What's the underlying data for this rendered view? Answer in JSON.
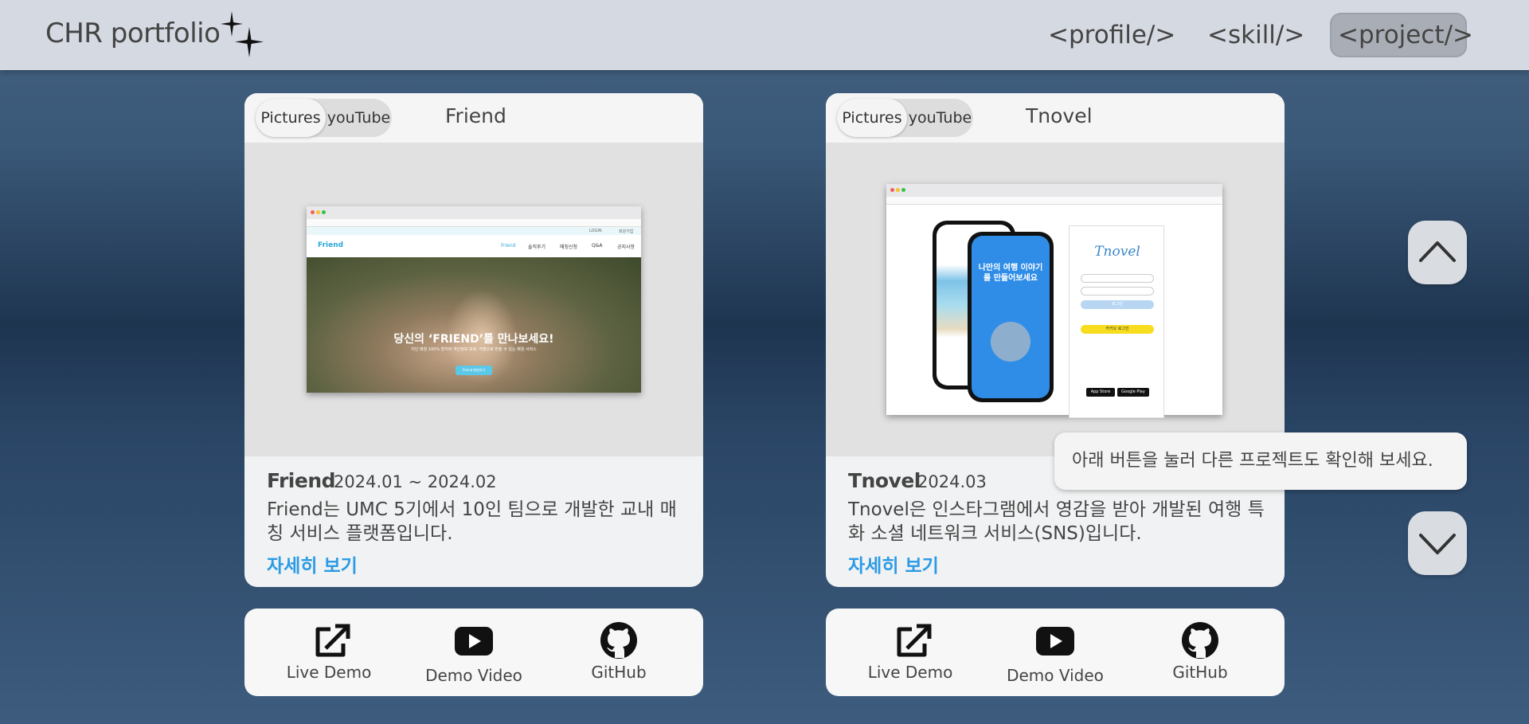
{
  "header": {
    "brand": "CHR portfolio",
    "nav": [
      {
        "label": "<profile/>",
        "active": false
      },
      {
        "label": "<skill/>",
        "active": false
      },
      {
        "label": "<project/>",
        "active": true
      }
    ]
  },
  "toggle": {
    "pictures": "Pictures",
    "youtube": "youTube"
  },
  "projects": [
    {
      "name": "Friend",
      "date": "2024.01 ~ 2024.02",
      "description": "Friend는 UMC 5기에서 10인 팀으로 개발한 교내 매칭 서비스 플랫폼입니다.",
      "more": "자세히 보기",
      "screenshot": {
        "logo": "Friend",
        "menu": [
          "Friend",
          "솔직후기",
          "매칭신청",
          "Q&A",
          "공지사항"
        ],
        "topbar": [
          "LOGIN",
          "회원가입"
        ],
        "headline": "당신의 ‘FRIEND’를 만나보세요!",
        "subline": "지인 매칭 100% 방지와 개인정보 보호, 익명으로 믿을 수 있는 매칭 서비스",
        "button": "Friend 매칭하기"
      }
    },
    {
      "name": "Tnovel",
      "date": "2024.03",
      "description": "Tnovel은 인스타그램에서 영감을 받아 개발된 여행 특화 소셜 네트워크 서비스(SNS)입니다.",
      "more": "자세히 보기",
      "screenshot": {
        "logo": "Tnovel",
        "phone_text": "나만의 여행 이야기를 만들어보세요",
        "login": "로그인",
        "kakao": "카카오 로그인",
        "app_store": "App Store",
        "google_play": "Google Play"
      }
    }
  ],
  "links": {
    "demo": "Live Demo",
    "video": "Demo Video",
    "github": "GitHub"
  },
  "tooltip": "아래 버튼을 눌러 다른 프로젝트도 확인해 보세요.",
  "colors": {
    "accent": "#2b9be6",
    "header": "#d5d9e2",
    "card": "#f1f2f3"
  },
  "icons": [
    "sparkle-icon",
    "external-link-icon",
    "youtube-icon",
    "github-icon",
    "chevron-up-icon",
    "chevron-down-icon"
  ]
}
